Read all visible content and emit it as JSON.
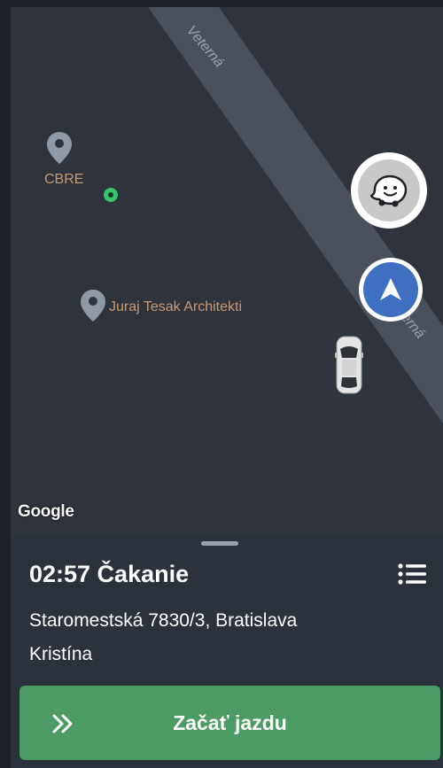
{
  "map": {
    "street_name_top": "Veterná",
    "street_name_right": "erná",
    "pois": [
      {
        "name": "CBRE"
      },
      {
        "name": "Juraj Tesak Architekti"
      }
    ],
    "attribution": "Google",
    "buttons": {
      "waze_icon": "waze-icon",
      "navigate_icon": "navigation-arrow-icon"
    },
    "colors": {
      "map_bg": "#2e333c",
      "road": "#4a515c",
      "poi_label": "#c99a74",
      "nav_blue": "#3f6fc1",
      "green_dot": "#37c46e"
    }
  },
  "ride": {
    "status": "02:57 Čakanie",
    "address": "Staromestská 7830/3, Bratislava",
    "passenger": "Kristína",
    "menu_icon": "list-icon",
    "start_button": {
      "label": "Začať jazdu",
      "icon": "double-chevron-right-icon",
      "color": "#4c9b64"
    }
  }
}
